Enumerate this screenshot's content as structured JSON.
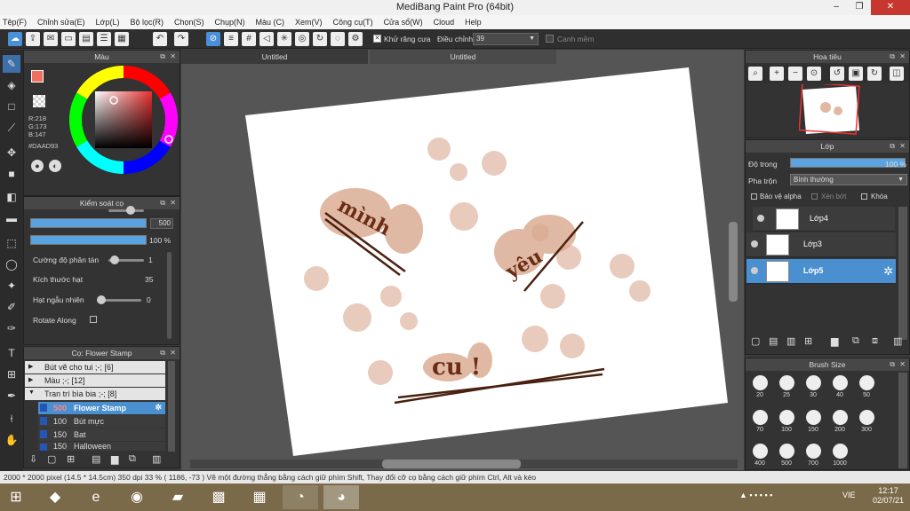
{
  "window": {
    "title": "MediBang Paint Pro (64bit)",
    "min": "–",
    "restore": "❐",
    "close": "✕"
  },
  "menu": [
    "Tệp(F)",
    "Chỉnh sửa(E)",
    "Lớp(L)",
    "Bộ lọc(R)",
    "Chọn(S)",
    "Chụp(N)",
    "Màu (C)",
    "Xem(V)",
    "Công cụ(T)",
    "Cửa sổ(W)",
    "Cloud",
    "Help"
  ],
  "toolbar": {
    "antialias_label": "Khử răng cưa",
    "adjust_label": "Điều chỉnh",
    "adjust_value": "39",
    "snap_label": "Canh mềm",
    "check": "✕"
  },
  "panels": {
    "color": {
      "title": "Màu",
      "r": "R:218",
      "g": "G:173",
      "b": "B:147",
      "hex": "#DAAD93"
    },
    "brush_control": {
      "title": "Kiểm soát cọ",
      "size_value": "500",
      "opacity_value": "100 %",
      "params": [
        {
          "label": "Cường độ phân tán",
          "value": "1"
        },
        {
          "label": "Kích thước hạt",
          "value": "35"
        },
        {
          "label": "Hạt ngẫu nhiên",
          "value": "0"
        },
        {
          "label": "Rotate Along",
          "value": ""
        }
      ]
    },
    "stamp": {
      "title": "Cọ: Flower Stamp",
      "groups": [
        {
          "arrow": "▶",
          "label": "Bút vẽ cho tui ;-; [6]"
        },
        {
          "arrow": "▶",
          "label": "Màu ;-; [12]"
        },
        {
          "arrow": "▼",
          "label": "Tran trí bìa bia ;-; [8]"
        }
      ],
      "items": [
        {
          "size": "500",
          "label": "Flower Stamp"
        },
        {
          "size": "100",
          "label": "Bút mực"
        },
        {
          "size": "150",
          "label": "Bat"
        },
        {
          "size": "150",
          "label": "Halloween"
        }
      ]
    },
    "navigator": {
      "title": "Hoa tiêu"
    },
    "layers": {
      "title": "Lớp",
      "opacity_label": "Độ trong",
      "opacity_value": "100 %",
      "blend_label": "Pha trộn",
      "blend_value": "Bình thường",
      "protect_alpha": "Bảo vệ alpha",
      "clipping": "Xén bớt",
      "lock": "Khóa",
      "items": [
        "Lớp4",
        "Lớp3",
        "Lớp5"
      ]
    },
    "brush_size": {
      "title": "Brush Size",
      "sizes": [
        "20",
        "25",
        "30",
        "40",
        "50",
        "70",
        "100",
        "150",
        "200",
        "300",
        "400",
        "500",
        "700",
        "1000"
      ]
    }
  },
  "canvas": {
    "tabs": [
      "Untitled",
      "Untitled"
    ],
    "art_words": [
      "mình",
      "yêu",
      "cu !"
    ]
  },
  "status": {
    "text": "2000 * 2000 pixel   (14.5 * 14.5cm)   350 dpi   33 %   ( 1186, -73 )   Vẽ một đường thẳng bằng cách giữ phím Shift, Thay đổi cỡ cọ bằng cách giữ phím Ctrl, Alt và kéo"
  },
  "taskbar": {
    "lang": "VIE",
    "time": "12:17",
    "date": "02/07/21"
  }
}
